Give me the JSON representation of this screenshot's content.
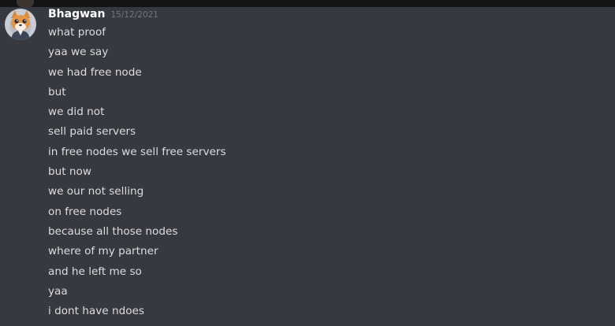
{
  "author": {
    "name": "Bhagwan",
    "timestamp": "15/12/2021",
    "avatar_icon": "cat-avatar-icon"
  },
  "messages": [
    "what proof",
    "yaa we say",
    "we had free node",
    "but",
    "we did not",
    "sell paid servers",
    "in free nodes we sell free servers",
    "but now",
    "we our not selling",
    "on free nodes",
    "because all those nodes",
    "where of my partner",
    "and he left me so",
    "yaa",
    "i dont have ndoes"
  ],
  "colors": {
    "background": "#36393f",
    "username": "#ffffff",
    "message_text": "#dcddde",
    "timestamp": "#72767d"
  }
}
